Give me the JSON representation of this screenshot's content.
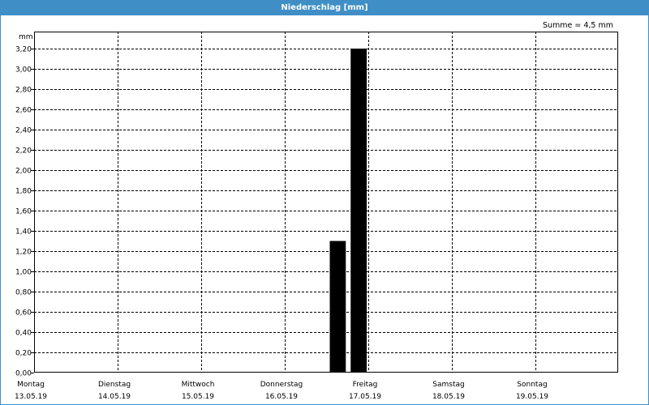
{
  "window": {
    "title": "Niederschlag [mm]"
  },
  "chart_data": {
    "type": "bar",
    "title": "Niederschlag [mm]",
    "ylabel": "mm",
    "sum_label": "Summe = 4,5 mm",
    "ylim": [
      0,
      3.2
    ],
    "y_ticks": [
      "0,00",
      "0,20",
      "0,40",
      "0,60",
      "0,80",
      "1,00",
      "1,20",
      "1,40",
      "1,60",
      "1,80",
      "2,00",
      "2,20",
      "2,40",
      "2,60",
      "2,80",
      "3,00",
      "3,20"
    ],
    "x_ticks": [
      {
        "day": "Montag",
        "date": "13.05.19"
      },
      {
        "day": "Dienstag",
        "date": "14.05.19"
      },
      {
        "day": "Mittwoch",
        "date": "15.05.19"
      },
      {
        "day": "Donnerstag",
        "date": "16.05.19"
      },
      {
        "day": "Freitag",
        "date": "17.05.19"
      },
      {
        "day": "Samstag",
        "date": "18.05.19"
      },
      {
        "day": "Sonntag",
        "date": "19.05.19"
      }
    ],
    "grid": true,
    "bar_color": "#000000",
    "bars": [
      {
        "period": "16.05.19 12:00-18:00",
        "value": 1.3
      },
      {
        "period": "16.05.19 18:00-24:00",
        "value": 3.2
      }
    ]
  }
}
